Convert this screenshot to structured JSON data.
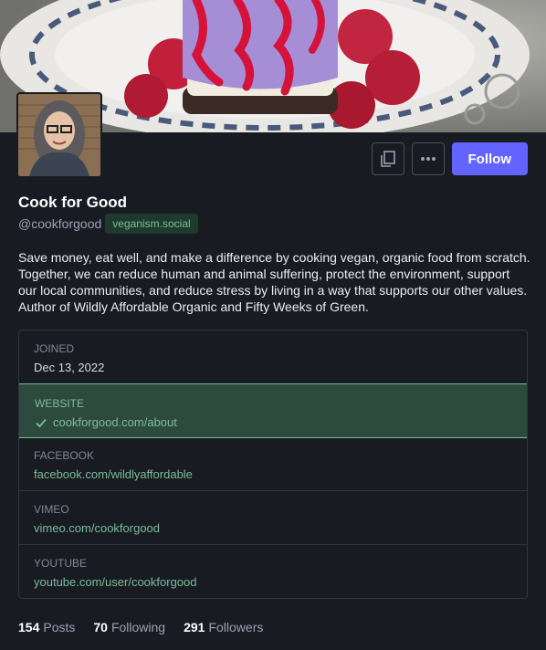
{
  "profile": {
    "display_name": "Cook for Good",
    "handle": "@cookforgood",
    "domain": "veganism.social",
    "bio": "Save money, eat well, and make a difference by cooking vegan, organic food from scratch. Together, we can reduce human and animal suffering, protect the environment, support our local communities, and reduce stress by living in a way that supports our other values. Author of Wildly Affordable Organic and Fifty Weeks of Green."
  },
  "actions": {
    "copy_icon": "copy-icon",
    "more_icon": "ellipsis-icon",
    "follow_label": "Follow"
  },
  "fields": [
    {
      "label": "JOINED",
      "value": "Dec 13, 2022",
      "verified": false
    },
    {
      "label": "WEBSITE",
      "value": "cookforgood.com/about",
      "verified": true
    },
    {
      "label": "FACEBOOK",
      "value": "facebook.com/wildlyaffordable",
      "verified": false
    },
    {
      "label": "VIMEO",
      "value": "vimeo.com/cookforgood",
      "verified": false
    },
    {
      "label": "YOUTUBE",
      "value": "youtube.com/user/cookforgood",
      "verified": false
    }
  ],
  "stats": {
    "posts_count": "154",
    "posts_label": "Posts",
    "following_count": "70",
    "following_label": "Following",
    "followers_count": "291",
    "followers_label": "Followers"
  },
  "colors": {
    "background": "#191b22",
    "accent": "#6364ff",
    "verified": "#79bd9a"
  }
}
